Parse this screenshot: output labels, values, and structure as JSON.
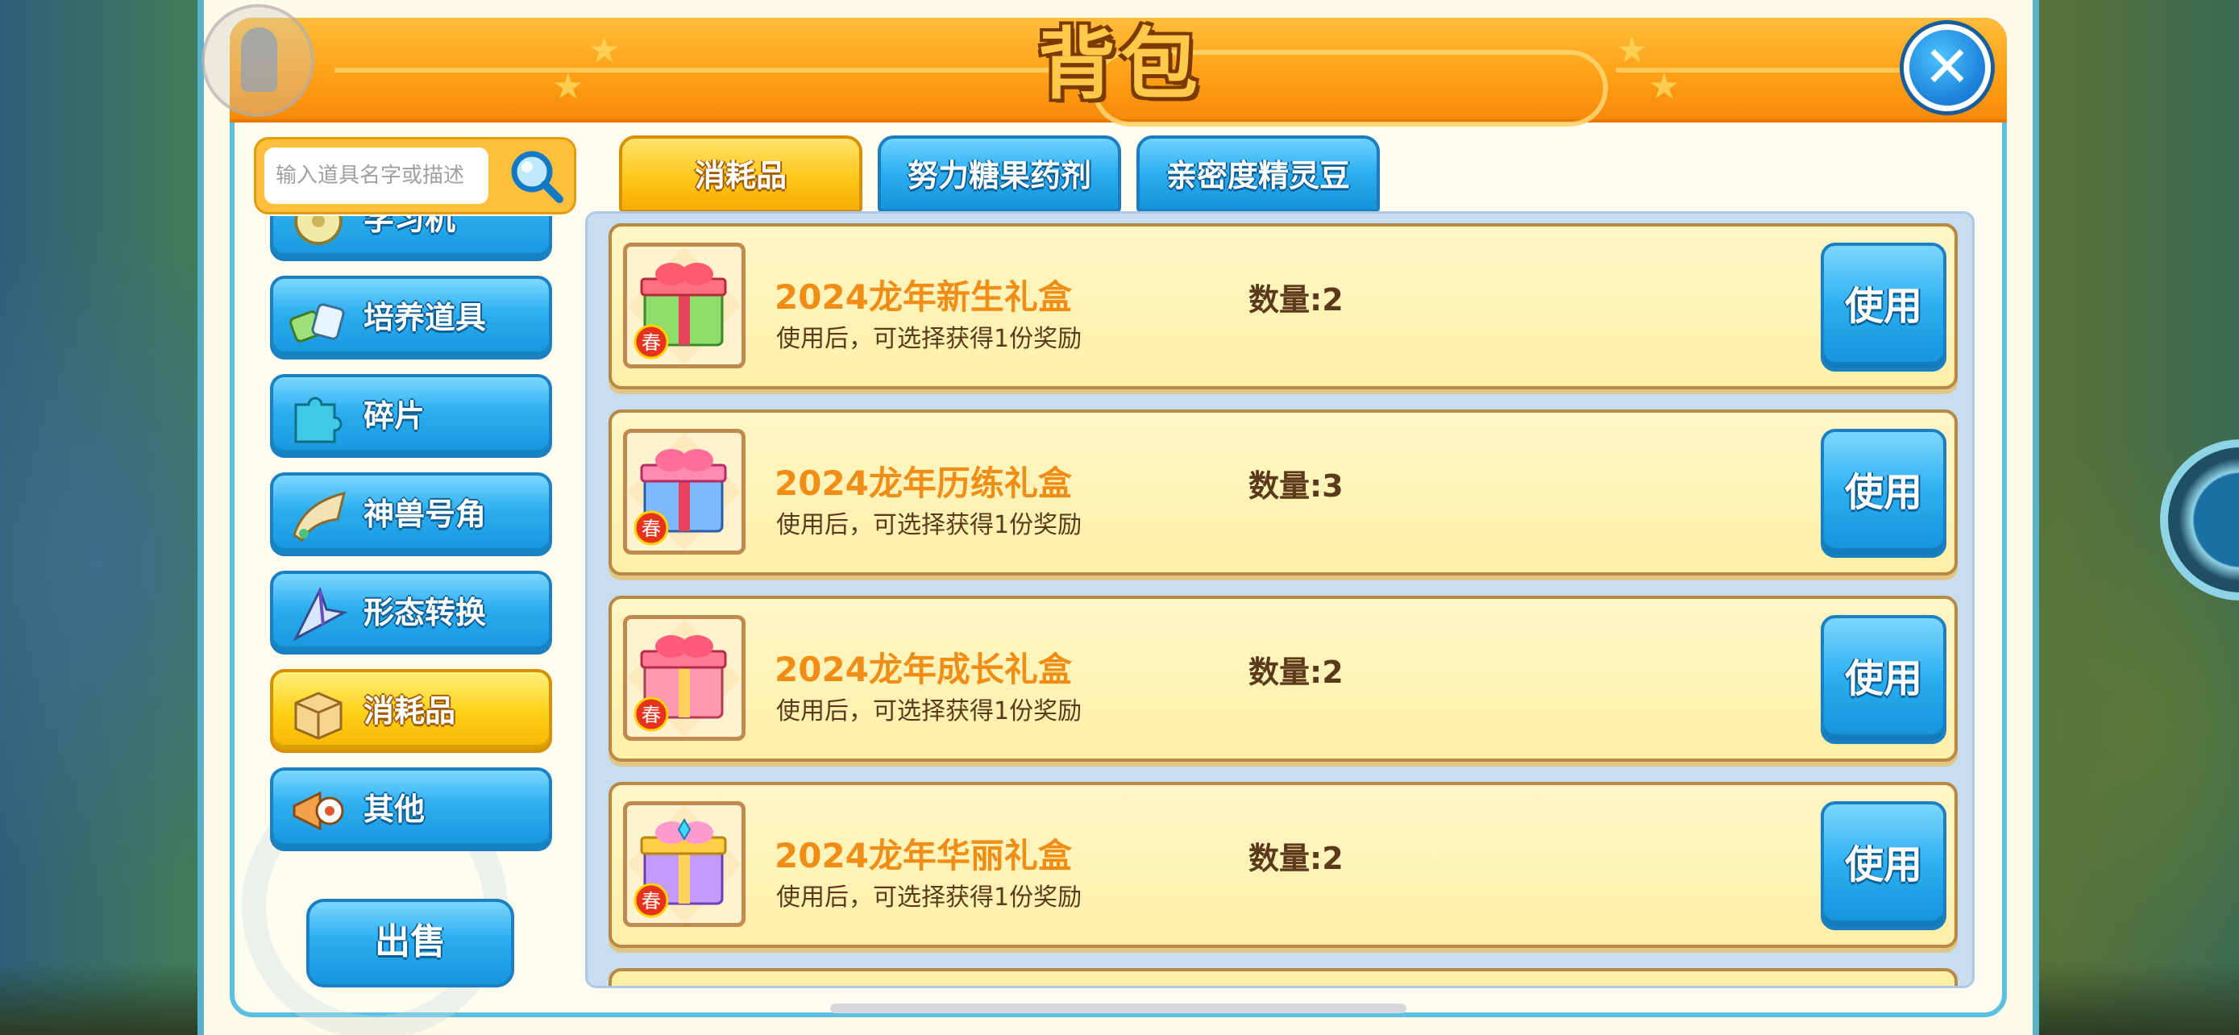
{
  "window": {
    "title": "背包"
  },
  "search": {
    "placeholder": "输入道具名字或描述"
  },
  "sidebar": {
    "items": [
      {
        "label": "学习机",
        "icon": "disc-icon",
        "active": false
      },
      {
        "label": "培养道具",
        "icon": "training-items-icon",
        "active": false
      },
      {
        "label": "碎片",
        "icon": "puzzle-icon",
        "active": false
      },
      {
        "label": "神兽号角",
        "icon": "horn-icon",
        "active": false
      },
      {
        "label": "形态转换",
        "icon": "transform-icon",
        "active": false
      },
      {
        "label": "消耗品",
        "icon": "box-icon",
        "active": true
      },
      {
        "label": "其他",
        "icon": "megaphone-icon",
        "active": false
      }
    ],
    "sell_label": "出售"
  },
  "tabs": [
    {
      "label": "消耗品",
      "active": true
    },
    {
      "label": "努力糖果药剂",
      "active": false
    },
    {
      "label": "亲密度精灵豆",
      "active": false
    }
  ],
  "items": [
    {
      "name": "2024龙年新生礼盒",
      "desc": "使用后，可选择获得1份奖励",
      "qty": "数量:2",
      "use_label": "使用",
      "badge": "春",
      "color": "green-red-giftbox"
    },
    {
      "name": "2024龙年历练礼盒",
      "desc": "使用后，可选择获得1份奖励",
      "qty": "数量:3",
      "use_label": "使用",
      "badge": "春",
      "color": "blue-pink-giftbox"
    },
    {
      "name": "2024龙年成长礼盒",
      "desc": "使用后，可选择获得1份奖励",
      "qty": "数量:2",
      "use_label": "使用",
      "badge": "春",
      "color": "pink-giftbox"
    },
    {
      "name": "2024龙年华丽礼盒",
      "desc": "使用后，可选择获得1份奖励",
      "qty": "数量:2",
      "use_label": "使用",
      "badge": "春",
      "color": "purple-yellow-giftbox"
    }
  ],
  "colors": {
    "header_orange": "#ff9f14",
    "button_blue": "#2aaef0",
    "active_yellow": "#ffd21a",
    "item_name": "#f08d16"
  }
}
